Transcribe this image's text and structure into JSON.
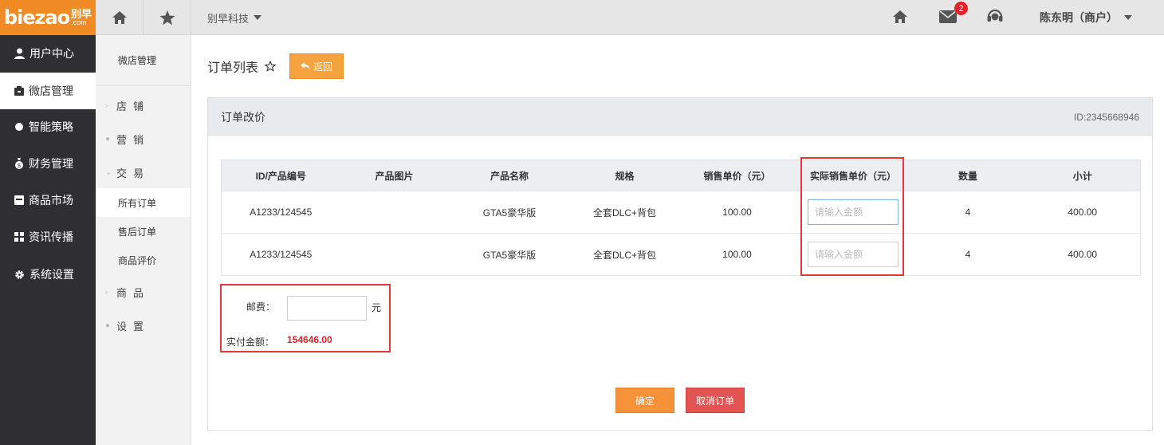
{
  "logo": {
    "brand": "biezao",
    "cn": "别早",
    "com": ".com"
  },
  "topbar": {
    "company": "别早科技",
    "mail_badge": "2",
    "user": "陈东明（商户）"
  },
  "leftnav": {
    "items": [
      {
        "label": "用户中心",
        "icon": "user-icon"
      },
      {
        "label": "微店管理",
        "icon": "shop-icon"
      },
      {
        "label": "智能策略",
        "icon": "dot-icon"
      },
      {
        "label": "财务管理",
        "icon": "money-bag-icon"
      },
      {
        "label": "商品市场",
        "icon": "market-icon"
      },
      {
        "label": "资讯传播",
        "icon": "grid-icon"
      },
      {
        "label": "系统设置",
        "icon": "gear-icon"
      }
    ]
  },
  "subnav": {
    "title": "微店管理",
    "groups": [
      {
        "label": "店铺",
        "mark": "›"
      },
      {
        "label": "营销",
        "mark": "●"
      },
      {
        "label": "交易",
        "mark": "⌄"
      },
      {
        "label": "商品",
        "mark": "›"
      },
      {
        "label": "设置",
        "mark": "●"
      }
    ],
    "children": [
      "所有订单",
      "售后订单",
      "商品评价"
    ]
  },
  "main": {
    "title": "订单列表",
    "back_label": "返回",
    "panel_title": "订单改价",
    "panel_id": "ID:2345668946",
    "table": {
      "columns": [
        "ID/产品编号",
        "产品图片",
        "产品名称",
        "规格",
        "销售单价（元）",
        "实际销售单价（元）",
        "数量",
        "小计"
      ],
      "rows": [
        {
          "id": "A1233/124545",
          "image": "",
          "name": "GTA5豪华版",
          "spec": "全套DLC+背包",
          "price": "100.00",
          "actual_price": "",
          "qty": "4",
          "subtotal": "400.00"
        },
        {
          "id": "A1233/124545",
          "image": "",
          "name": "GTA5豪华版",
          "spec": "全套DLC+背包",
          "price": "100.00",
          "actual_price": "",
          "qty": "4",
          "subtotal": "400.00"
        }
      ],
      "input_placeholder": "请输入金额"
    },
    "shipping_label": "邮费：",
    "shipping_value": "",
    "shipping_unit": "元",
    "paid_label": "实付金额：",
    "paid_value": "154646.00",
    "confirm_label": "确定",
    "cancel_label": "取消订单"
  },
  "colors": {
    "brand_orange": "#f08a24",
    "nav_dark": "#2f2f33",
    "accent_red": "#e23a3a",
    "paid_red": "#d9232d"
  }
}
